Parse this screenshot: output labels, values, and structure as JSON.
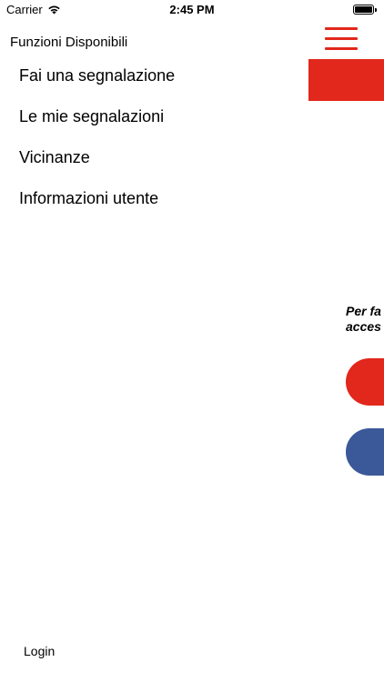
{
  "status_bar": {
    "carrier": "Carrier",
    "time": "2:45 PM"
  },
  "drawer": {
    "title": "Funzioni Disponibili",
    "items": [
      {
        "label": "Fai una segnalazione"
      },
      {
        "label": "Le mie segnalazioni"
      },
      {
        "label": "Vicinanze"
      },
      {
        "label": "Informazioni utente"
      }
    ],
    "login_label": "Login"
  },
  "background_page": {
    "info_line_1": "Per fa",
    "info_line_2": "acces"
  },
  "colors": {
    "accent_red": "#e2271c",
    "facebook_blue": "#3b5998"
  },
  "icons": {
    "menu": "hamburger-menu-icon",
    "wifi": "wifi-icon",
    "battery": "battery-icon"
  }
}
